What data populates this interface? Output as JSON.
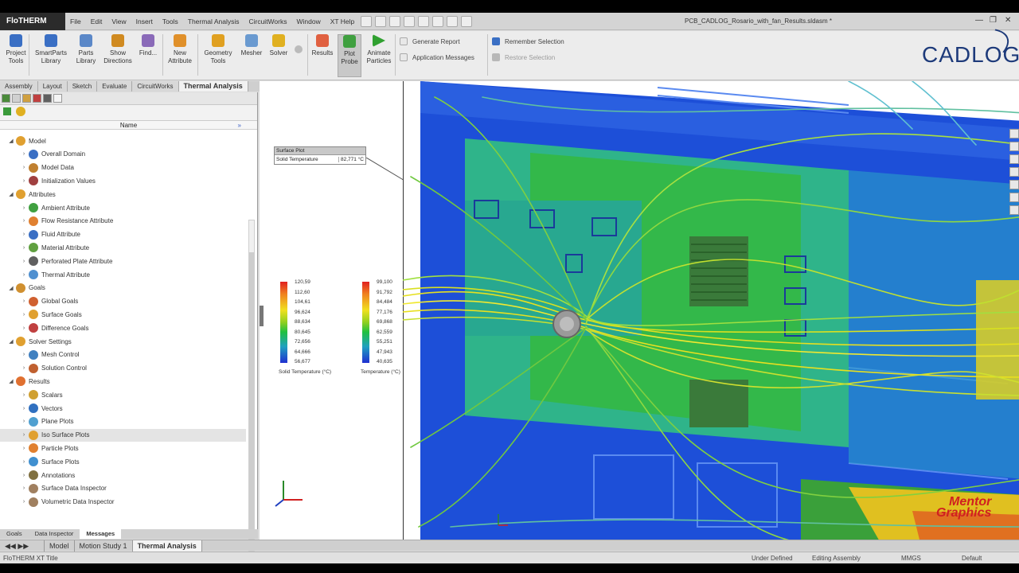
{
  "app": {
    "brand": "FloTHERM XT",
    "document_title": "PCB_CADLOG_Rosario_with_fan_Results.sldasm *",
    "menu": [
      "File",
      "Edit",
      "View",
      "Insert",
      "Tools",
      "Thermal Analysis",
      "CircuitWorks",
      "Window",
      "XT Help"
    ]
  },
  "ribbon": {
    "buttons": [
      {
        "label": "Project Tools",
        "icon": "project-tools-icon",
        "color": "#3a6fc4"
      },
      {
        "label": "SmartParts Library",
        "icon": "smartparts-icon",
        "color": "#3a6fc4"
      },
      {
        "label": "Parts Library",
        "icon": "parts-library-icon",
        "color": "#5b88c8"
      },
      {
        "label": "Show Directions",
        "icon": "directions-icon",
        "color": "#d08a20"
      },
      {
        "label": "Find...",
        "icon": "find-icon",
        "color": "#8a6ab8"
      },
      {
        "label": "New Attribute",
        "icon": "attribute-icon",
        "color": "#e0902a"
      },
      {
        "label": "Geometry Tools",
        "icon": "geometry-icon",
        "color": "#e0a020"
      },
      {
        "label": "Mesher",
        "icon": "mesher-icon",
        "color": "#6a9ad0"
      },
      {
        "label": "Solver",
        "icon": "solver-icon",
        "color": "#e0b020"
      },
      {
        "label": "Results",
        "icon": "results-icon",
        "color": "#e06040"
      },
      {
        "label": "Plot Probe",
        "icon": "plot-probe-icon",
        "color": "#40a040"
      },
      {
        "label": "Animate Particles",
        "icon": "play-icon",
        "color": "#30a030"
      }
    ],
    "small": {
      "generate_report": "Generate Report",
      "application_messages": "Application Messages",
      "remember_selection": "Remember Selection",
      "restore_selection": "Restore Selection"
    },
    "logo": "CADLOG"
  },
  "tabs": [
    "Assembly",
    "Layout",
    "Sketch",
    "Evaluate",
    "CircuitWorks",
    "Thermal Analysis"
  ],
  "tree": {
    "column_header": "Name",
    "nodes": [
      {
        "label": "Model",
        "level": 0,
        "color": "#e0a030"
      },
      {
        "label": "Overall Domain",
        "level": 1,
        "color": "#3a6fc4"
      },
      {
        "label": "Model Data",
        "level": 1,
        "color": "#c08030"
      },
      {
        "label": "Initialization Values",
        "level": 1,
        "color": "#a04040"
      },
      {
        "label": "Attributes",
        "level": 0,
        "color": "#e0a030"
      },
      {
        "label": "Ambient Attribute",
        "level": 1,
        "color": "#40a040"
      },
      {
        "label": "Flow Resistance Attribute",
        "level": 1,
        "color": "#e08030"
      },
      {
        "label": "Fluid Attribute",
        "level": 1,
        "color": "#3a6fc4"
      },
      {
        "label": "Material Attribute",
        "level": 1,
        "color": "#60a040"
      },
      {
        "label": "Perforated Plate Attribute",
        "level": 1,
        "color": "#606060"
      },
      {
        "label": "Thermal Attribute",
        "level": 1,
        "color": "#5090d0"
      },
      {
        "label": "Goals",
        "level": 0,
        "color": "#d09030"
      },
      {
        "label": "Global Goals",
        "level": 1,
        "color": "#d06030"
      },
      {
        "label": "Surface Goals",
        "level": 1,
        "color": "#e0a030"
      },
      {
        "label": "Difference Goals",
        "level": 1,
        "color": "#c04040"
      },
      {
        "label": "Solver Settings",
        "level": 0,
        "color": "#e0a030"
      },
      {
        "label": "Mesh Control",
        "level": 1,
        "color": "#4080c0"
      },
      {
        "label": "Solution Control",
        "level": 1,
        "color": "#c06030"
      },
      {
        "label": "Results",
        "level": 0,
        "color": "#e07030"
      },
      {
        "label": "Scalars",
        "level": 1,
        "color": "#d0a030"
      },
      {
        "label": "Vectors",
        "level": 1,
        "color": "#3070c0"
      },
      {
        "label": "Plane Plots",
        "level": 1,
        "color": "#50a0d0"
      },
      {
        "label": "Iso Surface Plots",
        "level": 1,
        "color": "#e0a030",
        "selected": true
      },
      {
        "label": "Particle Plots",
        "level": 1,
        "color": "#e08030"
      },
      {
        "label": "Surface Plots",
        "level": 1,
        "color": "#4090d0"
      },
      {
        "label": "Annotations",
        "level": 1,
        "color": "#807040"
      },
      {
        "label": "Surface Data Inspector",
        "level": 1,
        "color": "#a08060"
      },
      {
        "label": "Volumetric Data Inspector",
        "level": 1,
        "color": "#a08060"
      }
    ]
  },
  "panel_bottom_tabs": [
    "Goals",
    "Data Inspector",
    "Messages"
  ],
  "probe": {
    "title": "Surface Plot",
    "label": "Solid Temperature",
    "value": "82,771 °C"
  },
  "legends": [
    {
      "values": [
        "120,59",
        "112,60",
        "104,61",
        "96,624",
        "88,634",
        "80,645",
        "72,656",
        "64,666",
        "56,677"
      ],
      "title": "Solid Temperature (°C)"
    },
    {
      "values": [
        "99,100",
        "91,792",
        "84,484",
        "77,176",
        "69,868",
        "62,559",
        "55,251",
        "47,943",
        "40,635"
      ],
      "title": "Temperature (°C)"
    }
  ],
  "watermark": {
    "line1": "Mentor",
    "line2": "Graphics"
  },
  "doc_tabs": [
    "Model",
    "Motion Study 1",
    "Thermal Analysis"
  ],
  "status": {
    "left": "FloTHERM XT Title",
    "under_defined": "Under Defined",
    "editing": "Editing Assembly",
    "units": "MMGS",
    "default": "Default"
  }
}
